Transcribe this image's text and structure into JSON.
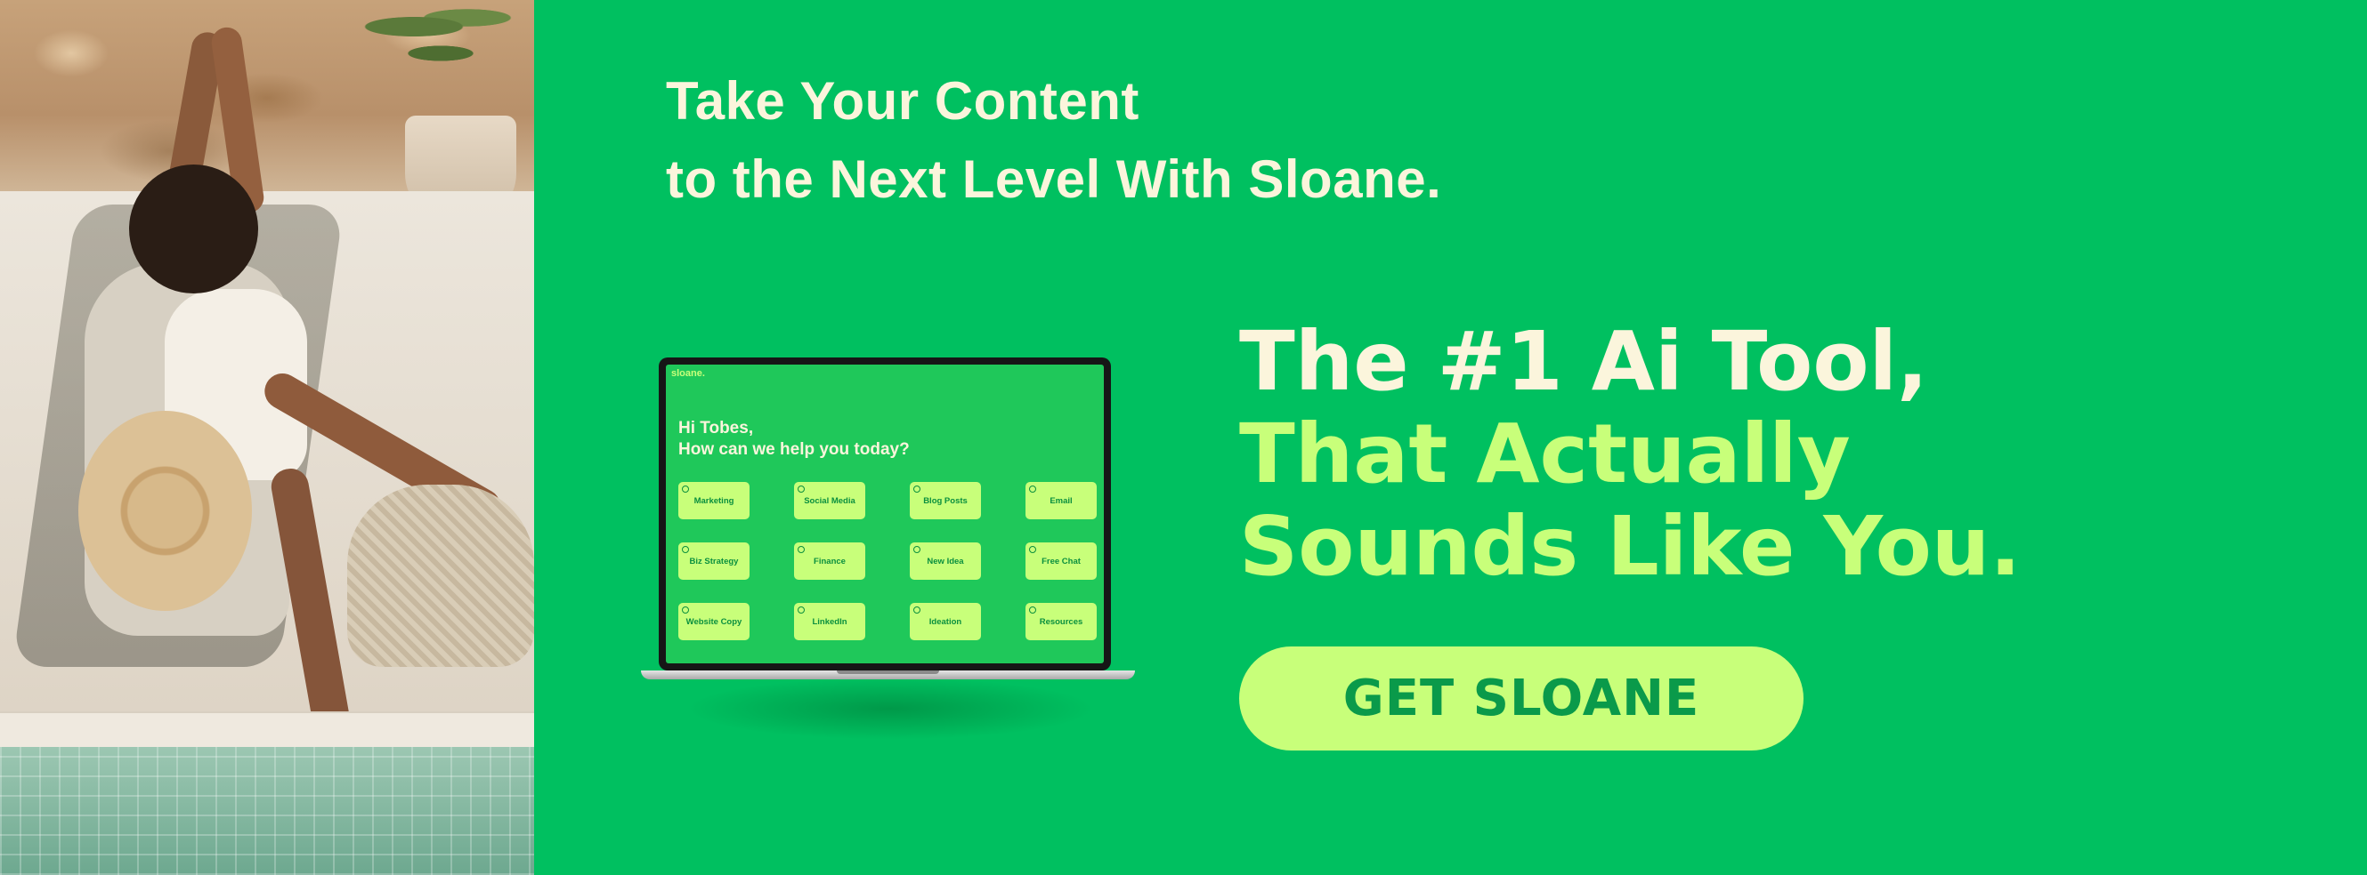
{
  "tagline": {
    "line1": "Take Your Content",
    "line2": "to the Next Level With Sloane."
  },
  "headline": {
    "line1": "The #1 Ai Tool,",
    "line2": "That Actually",
    "line3": "Sounds Like You."
  },
  "cta": {
    "label": "GET SLOANE"
  },
  "laptop_screen": {
    "brand": "sloane.",
    "greeting_line1": "Hi Tobes,",
    "greeting_line2": "How can we help you today?",
    "cards": [
      "Marketing",
      "Social Media",
      "Blog Posts",
      "Email",
      "Biz Strategy",
      "Finance",
      "New Idea",
      "Free Chat",
      "Website Copy",
      "LinkedIn",
      "Ideation",
      "Resources"
    ]
  },
  "colors": {
    "background": "#00c060",
    "cream_text": "#fbf5dc",
    "lime_accent": "#c8ff7a",
    "button_text": "#0a9a4a"
  }
}
